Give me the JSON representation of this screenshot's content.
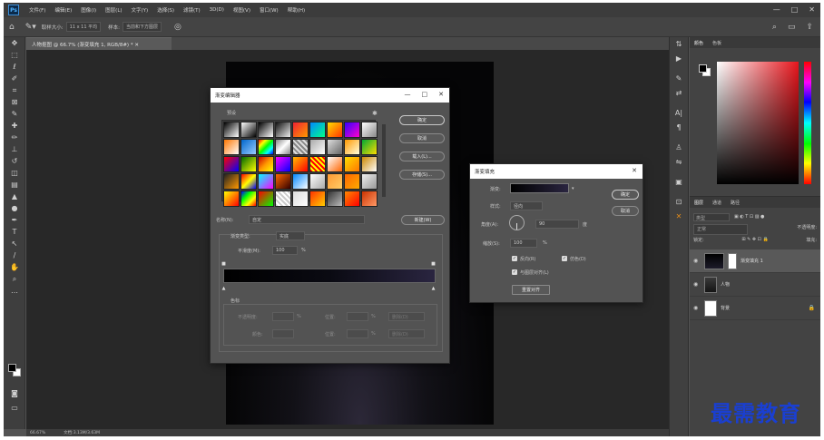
{
  "app": {
    "logo": "Ps",
    "menu": [
      "文件(F)",
      "编辑(E)",
      "图像(I)",
      "图层(L)",
      "文字(Y)",
      "选择(S)",
      "滤镜(T)",
      "3D(D)",
      "视图(V)",
      "窗口(W)",
      "帮助(H)"
    ],
    "window_controls": [
      "—",
      "□",
      "✕"
    ]
  },
  "options": {
    "sample_size_label": "取样大小:",
    "sample_size_value": "11 x 11 平均",
    "sample_label": "样本:",
    "sample_value": "当前和下方图层"
  },
  "document": {
    "tab_title": "人物抠图 @ 66.7% (渐变填充 1, RGB/8#) *  ✕",
    "zoom": "66.67%",
    "doc_info": "文档:3.13M/3.63M"
  },
  "panels": {
    "color_tabs": [
      "颜色",
      "色板"
    ],
    "layer_tabs": [
      "图层",
      "通道",
      "路径"
    ],
    "kind_label": "类型",
    "mode_value": "正常",
    "opacity_label": "不透明度:",
    "lock_label": "锁定:",
    "fill_label": "填充:",
    "layers": [
      {
        "name": "渐变填充 1",
        "selected": true
      },
      {
        "name": "人物",
        "selected": false
      },
      {
        "name": "背景",
        "selected": false
      }
    ]
  },
  "gradient_editor": {
    "title": "渐变编辑器",
    "presets_label": "预设",
    "ok": "确定",
    "cancel": "取消",
    "load": "载入(L)...",
    "save": "存储(S)...",
    "name_label": "名称(N):",
    "name_value": "自定",
    "new_button": "新建(W)",
    "type_label": "渐变类型:",
    "type_value": "实底",
    "smoothness_label": "平滑度(M):",
    "smoothness_value": "100",
    "percent": "%",
    "stops_label": "色标",
    "opacity_label": "不透明度:",
    "color_label": "颜色:",
    "location_label": "位置:",
    "delete_label": "删除(D)"
  },
  "gradient_fill": {
    "title": "渐变填充",
    "gradient_label": "渐变:",
    "style_label": "样式:",
    "style_value": "径向",
    "angle_label": "角度(A):",
    "angle_value": "90",
    "degree": "度",
    "scale_label": "缩放(S):",
    "scale_value": "100",
    "percent": "%",
    "reverse_label": "反向(R)",
    "dither_label": "仿色(D)",
    "align_label": "与图层对齐(L)",
    "reset_button": "重置对齐",
    "ok": "确定",
    "cancel": "取消"
  },
  "watermark": "最需教育",
  "colors": {
    "accent_red": "#e8151c",
    "watermark_blue": "#1a3fd1"
  }
}
